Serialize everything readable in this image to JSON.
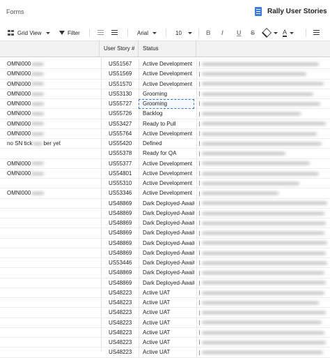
{
  "header": {
    "section_label": "Forms",
    "app_title": "Rally User Stories",
    "accent_color": "#3b7dd8"
  },
  "toolbar": {
    "view_label": "Grid View",
    "filter_label": "Filter",
    "font_name": "Arial",
    "font_size": "10",
    "bold_label": "B",
    "italic_label": "I",
    "underline_label": "U",
    "strike_label": "S",
    "text_color_label": "A"
  },
  "grid": {
    "columns": [
      "",
      "User Story #",
      "Status",
      ""
    ],
    "rows": [
      {
        "prefix": "OMNI000",
        "story": "US51567",
        "status": "Active Development"
      },
      {
        "prefix": "OMNI000",
        "story": "US51569",
        "status": "Active Development"
      },
      {
        "prefix": "OMNI000",
        "story": "US51570",
        "status": "Active Development"
      },
      {
        "prefix": "OMNI000",
        "story": "US53130",
        "status": "Grooming"
      },
      {
        "prefix": "OMNI000",
        "story": "US55727",
        "status": "Grooming"
      },
      {
        "prefix": "OMNI000",
        "story": "US55726",
        "status": "Backlog"
      },
      {
        "prefix": "OMNI000",
        "story": "US53427",
        "status": "Ready to Pull"
      },
      {
        "prefix": "OMNI000",
        "story": "US55764",
        "status": "Active Development"
      },
      {
        "prefix": "no SN tick",
        "prefix_suffix": "ber yet",
        "story": "US55420",
        "status": "Defined"
      },
      {
        "prefix": "",
        "story": "US55378",
        "status": "Ready for QA"
      },
      {
        "prefix": "OMNI000",
        "story": "US55377",
        "status": "Active Development"
      },
      {
        "prefix": "OMNI000",
        "story": "US54801",
        "status": "Active Development"
      },
      {
        "prefix": "",
        "story": "US55310",
        "status": "Active Development"
      },
      {
        "prefix": "OMNI000",
        "story": "US53346",
        "status": "Active Development"
      },
      {
        "prefix": "",
        "story": "US48869",
        "status": "Dark Deployed-Await"
      },
      {
        "prefix": "",
        "story": "US48869",
        "status": "Dark Deployed-Await"
      },
      {
        "prefix": "",
        "story": "US48869",
        "status": "Dark Deployed-Await"
      },
      {
        "prefix": "",
        "story": "US48869",
        "status": "Dark Deployed-Await"
      },
      {
        "prefix": "",
        "story": "US48869",
        "status": "Dark Deployed-Await"
      },
      {
        "prefix": "",
        "story": "US48869",
        "status": "Dark Deployed-Await"
      },
      {
        "prefix": "",
        "story": "US53446",
        "status": "Dark Deployed-Await"
      },
      {
        "prefix": "",
        "story": "US48869",
        "status": "Dark Deployed-Await"
      },
      {
        "prefix": "",
        "story": "US48869",
        "status": "Dark Deployed-Await"
      },
      {
        "prefix": "",
        "story": "US48223",
        "status": "Active UAT"
      },
      {
        "prefix": "",
        "story": "US48223",
        "status": "Active UAT"
      },
      {
        "prefix": "",
        "story": "US48223",
        "status": "Active UAT"
      },
      {
        "prefix": "",
        "story": "US48223",
        "status": "Active UAT"
      },
      {
        "prefix": "",
        "story": "US48223",
        "status": "Active UAT"
      },
      {
        "prefix": "",
        "story": "US48223",
        "status": "Active UAT"
      },
      {
        "prefix": "",
        "story": "US48223",
        "status": "Active UAT"
      }
    ],
    "selected_row": 4
  }
}
